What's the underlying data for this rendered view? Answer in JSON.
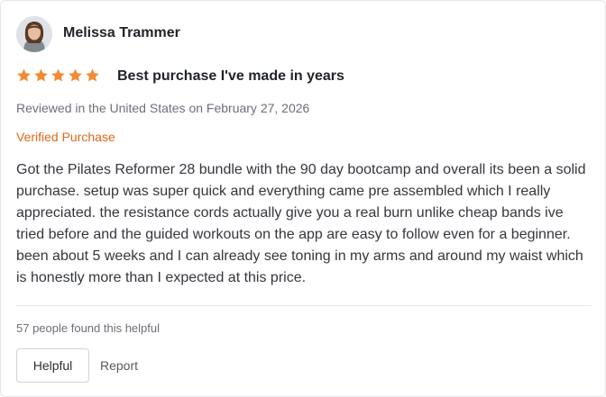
{
  "review": {
    "reviewer_name": "Melissa Trammer",
    "rating": 5,
    "rating_max": 5,
    "star_color": "#f58a32",
    "title": "Best purchase I've made in years",
    "meta": "Reviewed in the United States on February 27, 2026",
    "verified_label": "Verified Purchase",
    "verified_color": "#e0681a",
    "body": "Got the Pilates Reformer 28 bundle with the 90 day bootcamp and overall its been a solid purchase. setup was super quick and everything came pre assembled which I really appreciated. the resistance cords actually give you a real burn unlike cheap bands ive tried before and the guided workouts on the app are easy to follow even for a beginner. been about 5 weeks and I can already see toning in my arms and around my waist which is honestly more than I expected at this price.",
    "helpful_count_text": "57 people found this helpful",
    "helpful_button_label": "Helpful",
    "report_label": "Report"
  }
}
